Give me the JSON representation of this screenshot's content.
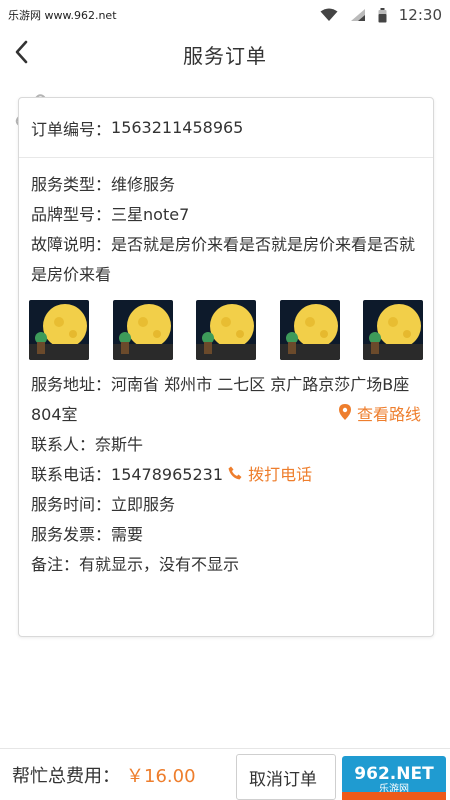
{
  "status_bar": {
    "watermark": "乐游网 www.962.net",
    "time": "12:30"
  },
  "header": {
    "title": "服务订单"
  },
  "order": {
    "number_label": "订单编号：",
    "number": "1563211458965",
    "service_type_label": "服务类型：",
    "service_type": "维修服务",
    "brand_model_label": "品牌型号：",
    "brand_model": "三星note7",
    "fault_label": "故障说明：",
    "fault": "是否就是房价来看是否就是房价来看是否就是房价来看",
    "address_label": "服务地址：",
    "address": "河南省 郑州市 二七区 京广路京莎广场B座804室",
    "view_route": "查看路线",
    "contact_label": "联系人：",
    "contact": "奈斯牛",
    "phone_label": "联系电话：",
    "phone": "15478965231",
    "call_label": "拨打电话",
    "time_label": "服务时间：",
    "time": "立即服务",
    "invoice_label": "服务发票：",
    "invoice": "需要",
    "remark_label": "备注：",
    "remark": "有就显示，没有不显示"
  },
  "bottom": {
    "fee_label": "帮忙总费用：",
    "fee_value": "￥16.00",
    "cancel_label": "取消订单",
    "logo_text": "962.NET",
    "logo_sub": "乐游网"
  },
  "colors": {
    "accent": "#ee7e2d",
    "text": "#333333",
    "border": "#d9d9d9"
  },
  "icons": [
    "wifi-icon",
    "signal-icon",
    "battery-icon",
    "back-arrow-icon",
    "paperclip-icon",
    "location-pin-icon",
    "phone-icon"
  ]
}
